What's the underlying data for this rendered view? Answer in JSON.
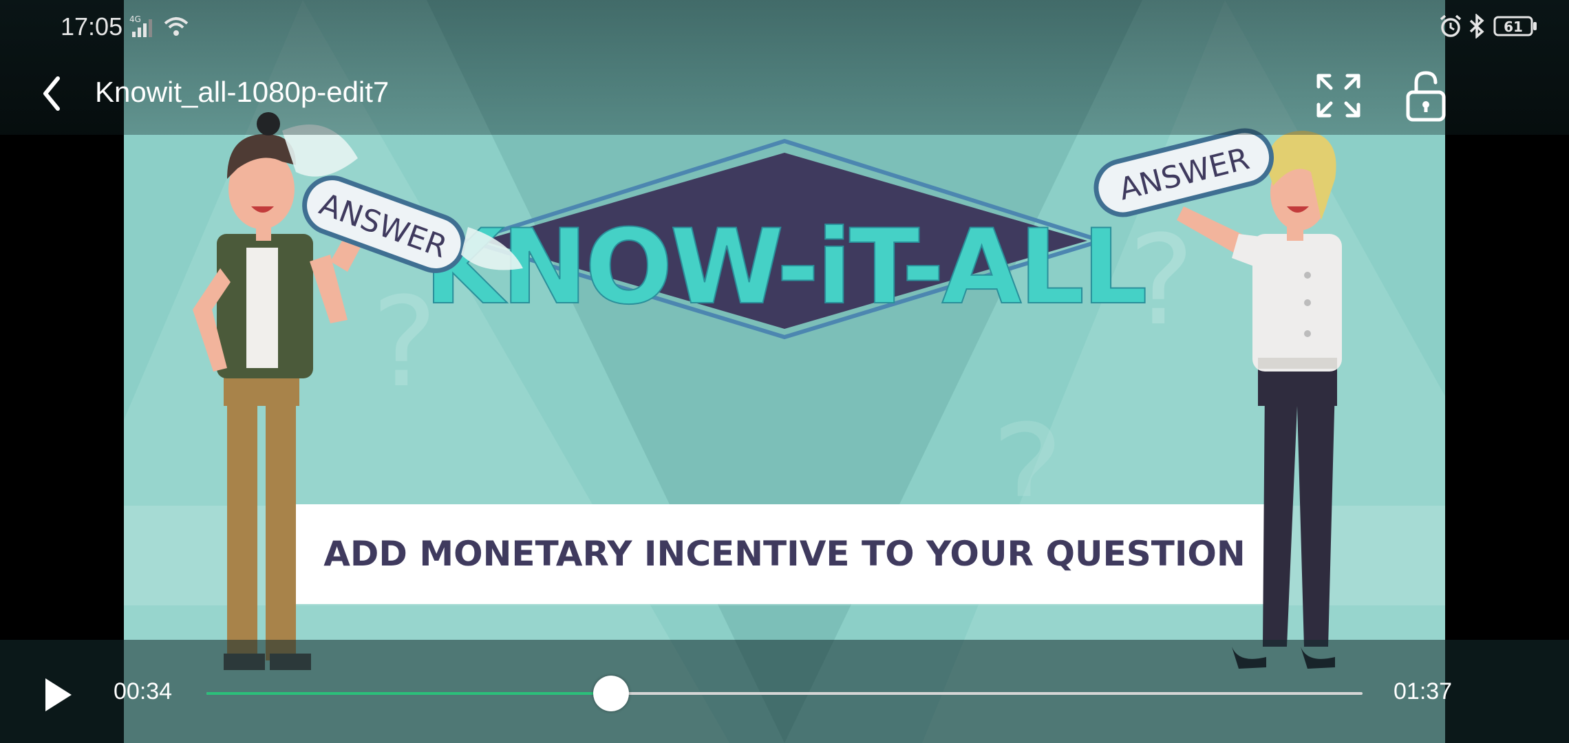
{
  "status_bar": {
    "time": "17:05",
    "network": "4G",
    "battery": "61",
    "icons": [
      "signal-icon",
      "wifi-icon",
      "alarm-icon",
      "bluetooth-icon",
      "battery-icon"
    ]
  },
  "player": {
    "title": "Knowit_all-1080p-edit7",
    "current_time": "00:34",
    "total_time": "01:37",
    "progress": 0.35,
    "icons": [
      "back-icon",
      "fullscreen-icon",
      "unlock-icon",
      "play-icon"
    ]
  },
  "video_frame": {
    "logo": "KNOW-iT-ALL",
    "left_tag": "ANSWER",
    "right_tag": "ANSWER",
    "banner": "ADD MONETARY INCENTIVE  TO YOUR QUESTION"
  },
  "colors": {
    "seek_played": "#2bbf7a",
    "seek_remaining": "#d6d6d6",
    "logo_fill": "#45d1c6",
    "diamond": "#3f3a5e",
    "background": "#7fc1b9"
  }
}
